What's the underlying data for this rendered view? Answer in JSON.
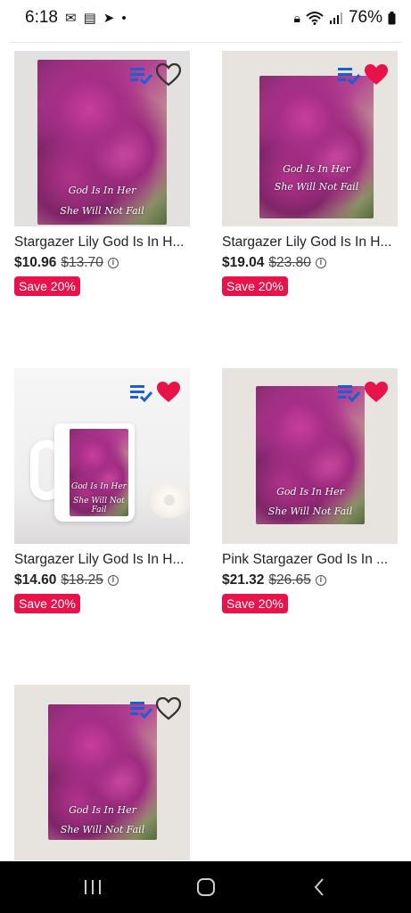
{
  "status_bar": {
    "time": "6:18",
    "battery": "76%",
    "icons_left": [
      "mail-icon",
      "calendar-icon",
      "telegram-icon",
      "dot-icon"
    ],
    "icons_right": [
      "lock-icon",
      "wifi-icon",
      "signal-icon",
      "battery-icon"
    ]
  },
  "products": [
    {
      "title": "Stargazer Lily God Is In H...",
      "price": "$10.96",
      "original_price": "$13.70",
      "discount": "Save 20%",
      "favorited": false,
      "image": "puzzle-gray",
      "art_text": [
        "God Is In Her",
        "She Will Not Fail"
      ]
    },
    {
      "title": "Stargazer Lily God Is In H...",
      "price": "$19.04",
      "original_price": "$23.80",
      "discount": "Save 20%",
      "favorited": true,
      "image": "puzzle-beige",
      "art_text": [
        "God Is In Her",
        "She Will Not Fail"
      ]
    },
    {
      "title": "Stargazer Lily God Is In H...",
      "price": "$14.60",
      "original_price": "$18.25",
      "discount": "Save 20%",
      "favorited": true,
      "image": "mug",
      "art_text": [
        "God Is In Her",
        "She Will Not Fail"
      ]
    },
    {
      "title": "Pink Stargazer God Is In ...",
      "price": "$21.32",
      "original_price": "$26.65",
      "discount": "Save 20%",
      "favorited": true,
      "image": "puzzle-beige",
      "art_text": [
        "God Is In Her",
        "She Will Not Fail"
      ]
    },
    {
      "title": "",
      "price": "",
      "original_price": "",
      "discount": "",
      "favorited": false,
      "image": "puzzle-beige",
      "art_text": [
        "God Is In Her",
        "She Will Not Fail"
      ]
    }
  ],
  "colors": {
    "accent": "#e8134b",
    "collection_blue": "#1a5fd6",
    "heart_red": "#e8134b"
  },
  "nav_bar": {
    "buttons": [
      "recent-apps-icon",
      "home-icon",
      "back-icon"
    ]
  }
}
